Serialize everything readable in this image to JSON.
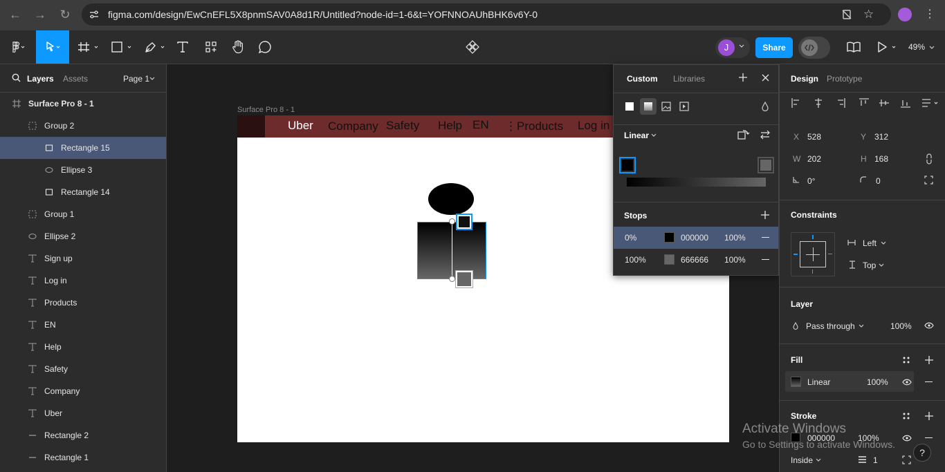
{
  "browser": {
    "url": "figma.com/design/EwCnEFL5X8pnmSAV0A8d1R/Untitled?node-id=1-6&t=YOFNNOAUhBHK6v6Y-0"
  },
  "toolbar": {
    "avatar_initial": "J",
    "share_label": "Share",
    "zoom": "49%"
  },
  "left_panel": {
    "tabs": [
      "Layers",
      "Assets"
    ],
    "page": "Page 1",
    "layers": [
      {
        "name": "Surface Pro 8 - 1",
        "icon": "frame-icon"
      },
      {
        "name": "Group 2",
        "icon": "group-icon"
      },
      {
        "name": "Rectangle 15",
        "icon": "rectangle-icon",
        "selected": true
      },
      {
        "name": "Ellipse 3",
        "icon": "ellipse-icon"
      },
      {
        "name": "Rectangle 14",
        "icon": "rectangle-icon"
      },
      {
        "name": "Group 1",
        "icon": "group-icon"
      },
      {
        "name": "Ellipse 2",
        "icon": "ellipse-icon"
      },
      {
        "name": "Sign up",
        "icon": "text-icon"
      },
      {
        "name": "Log in",
        "icon": "text-icon"
      },
      {
        "name": "Products",
        "icon": "text-icon"
      },
      {
        "name": "EN",
        "icon": "text-icon"
      },
      {
        "name": "Help",
        "icon": "text-icon"
      },
      {
        "name": "Safety",
        "icon": "text-icon"
      },
      {
        "name": "Company",
        "icon": "text-icon"
      },
      {
        "name": "Uber",
        "icon": "text-icon"
      },
      {
        "name": "Rectangle 2",
        "icon": "line-icon"
      },
      {
        "name": "Rectangle 1",
        "icon": "line-icon"
      }
    ]
  },
  "canvas": {
    "frame_label": "Surface Pro 8 - 1",
    "nav": {
      "uber": "Uber",
      "company": "Company",
      "safety": "Safety",
      "help": "Help",
      "en": "EN",
      "products": "⋮Products",
      "login": "Log in"
    }
  },
  "picker": {
    "tabs": [
      "Custom",
      "Libraries"
    ],
    "gradient_type": "Linear",
    "stops_title": "Stops",
    "stops": [
      {
        "position": "0%",
        "hex": "000000",
        "opacity": "100%",
        "color": "#000000"
      },
      {
        "position": "100%",
        "hex": "666666",
        "opacity": "100%",
        "color": "#666666"
      }
    ]
  },
  "design": {
    "tabs": [
      "Design",
      "Prototype"
    ],
    "x_label": "X",
    "x": "528",
    "y_label": "Y",
    "y": "312",
    "w_label": "W",
    "w": "202",
    "h_label": "H",
    "h": "168",
    "rotation": "0°",
    "radius": "0",
    "constraints_title": "Constraints",
    "constraint_h": "Left",
    "constraint_v": "Top",
    "layer_title": "Layer",
    "blend": "Pass through",
    "layer_opacity": "100%",
    "fill_title": "Fill",
    "fill_type": "Linear",
    "fill_opacity": "100%",
    "stroke_title": "Stroke",
    "stroke_hex": "000000",
    "stroke_opacity": "100%",
    "stroke_position": "Inside",
    "stroke_weight": "1"
  },
  "watermark": {
    "title": "Activate Windows",
    "subtitle": "Go to Settings to activate Windows."
  },
  "help": "?",
  "colors": {
    "accent": "#0d99ff",
    "nav_bar": "#6e2b2b",
    "selection": "#4a5878"
  }
}
